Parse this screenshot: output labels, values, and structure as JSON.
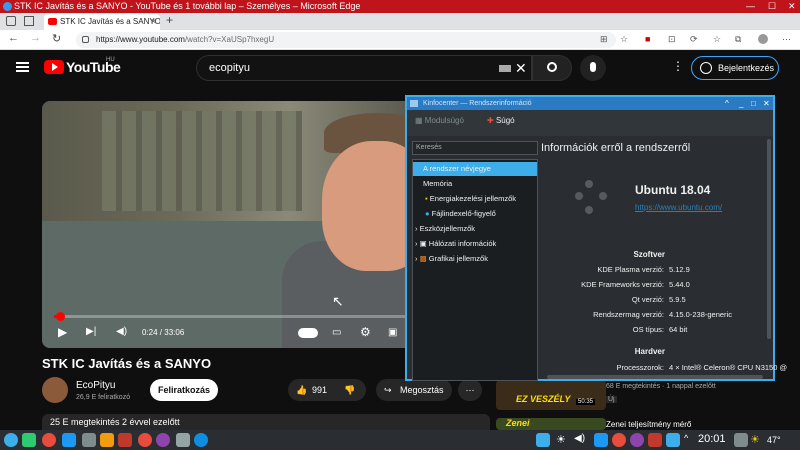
{
  "browser": {
    "window_title": "STK IC Javítás és a SANYO - YouTube és 1 további lap – Személyes – Microsoft​ Edge",
    "tab_title": "STK IC Javítás és a SANYO - Y",
    "url_host": "https://www.youtube.com",
    "url_path": "/watch?v=XaUSp7hxegU"
  },
  "youtube": {
    "logo_text": "YouTube",
    "region": "HU",
    "search_value": "ecopityu",
    "signin_label": "Bejelentkezés",
    "time_current": "0:24",
    "time_total": "33:06",
    "time_sep": " / ",
    "progress": 0.012,
    "video_title": "STK IC Javítás és a SANYO",
    "channel_name": "EcoPityu",
    "subscribers": "26,9 E feliratkozó",
    "subscribe_label": "Feliratkozás",
    "likes": "991",
    "share_label": "Megosztás",
    "description": "25 E megtekintés  2 évvel ezelőtt",
    "side": [
      {
        "meta": "68 E megtekintés · 1 nappal ezelőtt",
        "badge": "Új",
        "thumb_text": "EZ VESZÉLY",
        "duration": "50:35"
      },
      {
        "title": "Zenei teljesítmény mérő",
        "thumb_text": "Zenei"
      }
    ]
  },
  "kinfo": {
    "title": "Kinfocenter — Rendszerinformáció",
    "toolbar_module": "Modulsúgó",
    "toolbar_help": "Súgó",
    "search_placeholder": "Keresés",
    "tree": [
      {
        "label": "A rendszer névjegye",
        "selected": true
      },
      {
        "label": "Memória"
      },
      {
        "label": "Energiakezelési jellemzők"
      },
      {
        "label": "Fájlindexelő-figyelő"
      },
      {
        "label": "Eszközjellemzők"
      },
      {
        "label": "Hálózati információk"
      },
      {
        "label": "Grafikai jellemzők"
      }
    ],
    "heading": "Információk erről a rendszerről",
    "os_name": "Ubuntu 18.04",
    "os_url": "https://www.ubuntu.com/",
    "software_header": "Szoftver",
    "software": [
      {
        "label": "KDE Plasma verzió:",
        "value": "5.12.9"
      },
      {
        "label": "KDE Frameworks verzió:",
        "value": "5.44.0"
      },
      {
        "label": "Qt verzió:",
        "value": "5.9.5"
      },
      {
        "label": "Rendszermag verzió:",
        "value": "4.15.0-238-generic"
      },
      {
        "label": "OS típus:",
        "value": "64 bit"
      }
    ],
    "hardware_header": "Hardver",
    "hardware": [
      {
        "label": "Processzorok:",
        "value": "4 × Intel® Celeron® CPU N3150 @"
      }
    ]
  },
  "taskbar": {
    "clock": "20:01",
    "temperature": "47°"
  }
}
